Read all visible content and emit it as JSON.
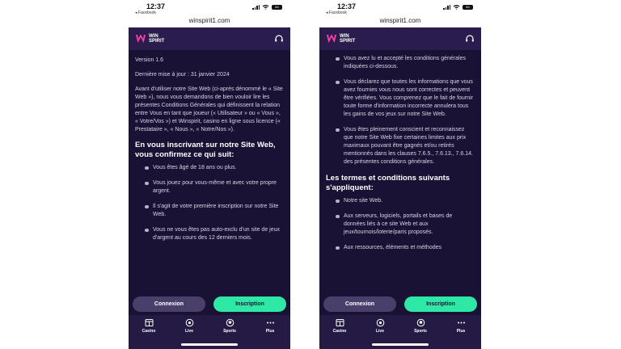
{
  "status_bar": {
    "time": "12:37",
    "back_label": "◂ Facebook",
    "battery": "84"
  },
  "browser": {
    "url": "winspirit1.com"
  },
  "header": {
    "logo_line1": "WIN",
    "logo_line2": "SPIRIT"
  },
  "left": {
    "version": "Version 1.6",
    "last_update": "Dernière mise à jour : 31 janvier 2024",
    "intro": "Avant d'utiliser notre Site Web (ci-après dénommé le « Site Web »), nous vous demandons de bien vouloir lire les présentes Conditions Générales qui définissent la relation entre Vous en tant que joueur (« Utilisateur » ou « Vous », « Votre/Vos ») et Winspirit, casino en ligne sous licence (« Prestataire », « Nous », « Notre/Nos »).",
    "section_title": "En vous inscrivant sur notre Site Web, vous confirmez ce qui suit:",
    "bullets": [
      "Vous êtes âgé de 18 ans ou plus.",
      "Vous jouez pour vous-même et avec votre propre argent.",
      "Il s'agit de votre première inscription sur notre Site Web.",
      "Vous ne vous êtes pas auto-exclu d'un site de jeux d'argent au cours des 12 derniers mois."
    ]
  },
  "right": {
    "bullets": [
      "Vous avez lu et accepté les conditions générales indiquées ci-dessous.",
      "Vous déclarez que toutes les informations que vous avez fournies vous nous sont correctes et peuvent être vérifiées. Vous comprenez que le fait de fournir toute forme d'information incorrecte annulera tous les gains de vos jeux sur notre Site Web.",
      "Vous êtes pleinement conscient et reconnaissez que notre Site Web fixe certaines limites aux prix maximaux pouvant être gagnés et/ou retirés mentionnés dans les clauses 7.6.5., 7.6.13., 7.6.14. des présentes conditions générales."
    ],
    "section_title": "Les termes et conditions suivants s'appliquent:",
    "bullets2": [
      "Notre site Web.",
      "Aux serveurs, logiciels, portails et bases de données liés à ce site Web et aux jeux/tournois/loterie/paris proposés.",
      "Aux ressources, éléments et méthodes"
    ]
  },
  "actions": {
    "login": "Connexion",
    "signup": "Inscription"
  },
  "nav": [
    {
      "label": "Casino",
      "icon": "casino-icon"
    },
    {
      "label": "Live",
      "icon": "live-icon"
    },
    {
      "label": "Sports",
      "icon": "sports-icon"
    },
    {
      "label": "Plus",
      "icon": "more-icon"
    }
  ],
  "colors": {
    "background": "#1a1234",
    "header": "#2a1d4e",
    "accent": "#2ee8a5",
    "login_button": "#4a3f6b",
    "logo_pink": "#ff3fa4"
  }
}
